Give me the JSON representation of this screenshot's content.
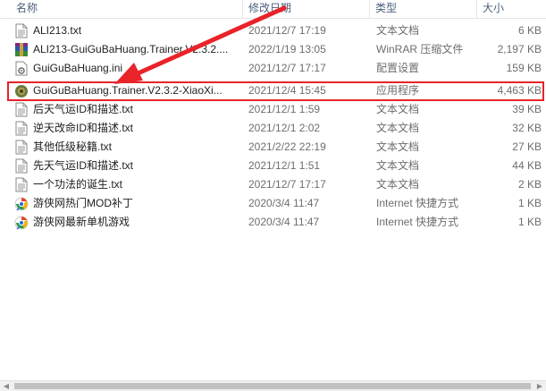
{
  "columns": {
    "name": "名称",
    "date": "修改日期",
    "type": "类型",
    "size": "大小"
  },
  "rows": [
    {
      "name": "ALI213.txt",
      "date": "2021/12/7 17:19",
      "type": "文本文档",
      "size": "6 KB",
      "icon": "text-file-icon"
    },
    {
      "name": "ALI213-GuiGuBaHuang.Trainer.V2.3.2....",
      "date": "2022/1/19 13:05",
      "type": "WinRAR 压缩文件",
      "size": "2,197 KB",
      "icon": "winrar-archive-icon"
    },
    {
      "name": "GuiGuBaHuang.ini",
      "date": "2021/12/7 17:17",
      "type": "配置设置",
      "size": "159 KB",
      "icon": "config-file-icon"
    },
    {
      "name": "GuiGuBaHuang.Trainer.V2.3.2-XiaoXi...",
      "date": "2021/12/4 15:45",
      "type": "应用程序",
      "size": "4,463 KB",
      "icon": "trainer-app-icon"
    },
    {
      "name": "后天气运ID和描述.txt",
      "date": "2021/12/1 1:59",
      "type": "文本文档",
      "size": "39 KB",
      "icon": "text-file-icon"
    },
    {
      "name": "逆天改命ID和描述.txt",
      "date": "2021/12/1 2:02",
      "type": "文本文档",
      "size": "32 KB",
      "icon": "text-file-icon"
    },
    {
      "name": "其他低级秘籍.txt",
      "date": "2021/2/22 22:19",
      "type": "文本文档",
      "size": "27 KB",
      "icon": "text-file-icon"
    },
    {
      "name": "先天气运ID和描述.txt",
      "date": "2021/12/1 1:51",
      "type": "文本文档",
      "size": "44 KB",
      "icon": "text-file-icon"
    },
    {
      "name": "一个功法的诞生.txt",
      "date": "2021/12/7 17:17",
      "type": "文本文档",
      "size": "2 KB",
      "icon": "text-file-icon"
    },
    {
      "name": "游侠网热门MOD补丁",
      "date": "2020/3/4 11:47",
      "type": "Internet 快捷方式",
      "size": "1 KB",
      "icon": "internet-shortcut-icon"
    },
    {
      "name": "游侠网最新单机游戏",
      "date": "2020/3/4 11:47",
      "type": "Internet 快捷方式",
      "size": "1 KB",
      "icon": "internet-shortcut-icon"
    }
  ],
  "highlight_color": "#e8232a"
}
